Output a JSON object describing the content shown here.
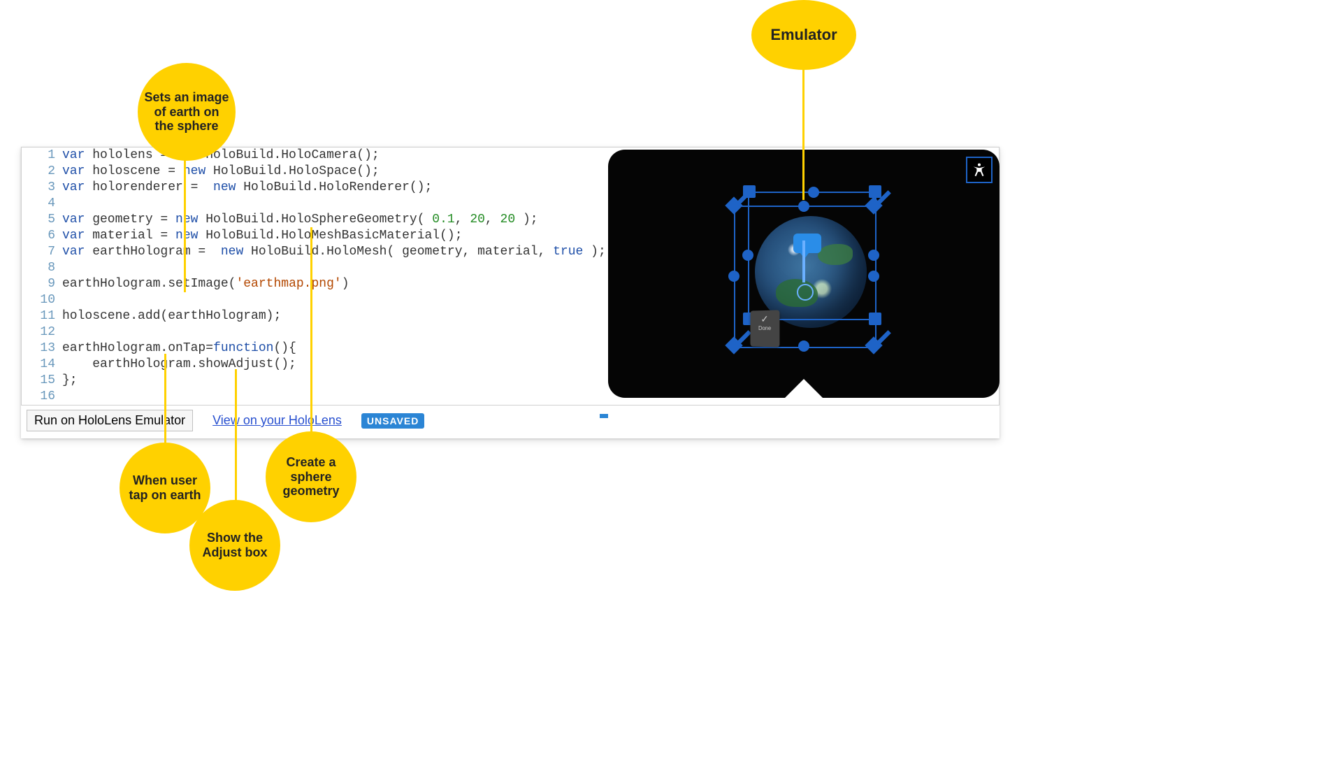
{
  "code": {
    "lines": [
      {
        "n": 1,
        "tokens": [
          [
            "kw",
            "var"
          ],
          [
            "",
            " hololens = "
          ],
          [
            "kw",
            "new"
          ],
          [
            "",
            " HoloBuild.HoloCamera();"
          ]
        ]
      },
      {
        "n": 2,
        "tokens": [
          [
            "kw",
            "var"
          ],
          [
            "",
            " holoscene = "
          ],
          [
            "kw",
            "new"
          ],
          [
            "",
            " HoloBuild.HoloSpace();"
          ]
        ]
      },
      {
        "n": 3,
        "tokens": [
          [
            "kw",
            "var"
          ],
          [
            "",
            " holorenderer =  "
          ],
          [
            "kw",
            "new"
          ],
          [
            "",
            " HoloBuild.HoloRenderer();"
          ]
        ]
      },
      {
        "n": 4,
        "tokens": [
          [
            "",
            ""
          ]
        ]
      },
      {
        "n": 5,
        "tokens": [
          [
            "kw",
            "var"
          ],
          [
            "",
            " geometry = "
          ],
          [
            "kw",
            "new"
          ],
          [
            "",
            " HoloBuild.HoloSphereGeometry( "
          ],
          [
            "num",
            "0.1"
          ],
          [
            "",
            ", "
          ],
          [
            "num",
            "20"
          ],
          [
            "",
            ", "
          ],
          [
            "num",
            "20"
          ],
          [
            "",
            " );"
          ]
        ]
      },
      {
        "n": 6,
        "tokens": [
          [
            "kw",
            "var"
          ],
          [
            "",
            " material = "
          ],
          [
            "kw",
            "new"
          ],
          [
            "",
            " HoloBuild.HoloMeshBasicMaterial();"
          ]
        ]
      },
      {
        "n": 7,
        "tokens": [
          [
            "kw",
            "var"
          ],
          [
            "",
            " earthHologram =  "
          ],
          [
            "kw",
            "new"
          ],
          [
            "",
            " HoloBuild.HoloMesh( geometry, material, "
          ],
          [
            "bool",
            "true"
          ],
          [
            "",
            " );"
          ]
        ]
      },
      {
        "n": 8,
        "tokens": [
          [
            "",
            ""
          ]
        ]
      },
      {
        "n": 9,
        "tokens": [
          [
            "",
            "earthHologram.setImage("
          ],
          [
            "str",
            "'earthmap.png'"
          ],
          [
            "",
            ")"
          ]
        ]
      },
      {
        "n": 10,
        "tokens": [
          [
            "",
            ""
          ]
        ]
      },
      {
        "n": 11,
        "tokens": [
          [
            "",
            "holoscene.add(earthHologram);"
          ]
        ]
      },
      {
        "n": 12,
        "tokens": [
          [
            "",
            ""
          ]
        ]
      },
      {
        "n": 13,
        "tokens": [
          [
            "",
            "earthHologram.onTap="
          ],
          [
            "kw",
            "function"
          ],
          [
            "",
            "(){"
          ]
        ]
      },
      {
        "n": 14,
        "tokens": [
          [
            "",
            "    earthHologram.showAdjust();"
          ]
        ]
      },
      {
        "n": 15,
        "tokens": [
          [
            "",
            "};"
          ]
        ]
      },
      {
        "n": 16,
        "tokens": [
          [
            "",
            ""
          ]
        ]
      }
    ]
  },
  "toolbar": {
    "run_label": "Run on HoloLens Emulator",
    "view_label": "View on your HoloLens",
    "status": "UNSAVED"
  },
  "emulator": {
    "icon": "Y",
    "menu_check": "✓",
    "menu_label": "Done"
  },
  "annotations": {
    "top": "Sets an image of earth on the sphere",
    "emulator": "Emulator",
    "tap": "When user tap on earth",
    "adjust": "Show the Adjust box",
    "create": "Create a sphere geometry"
  }
}
